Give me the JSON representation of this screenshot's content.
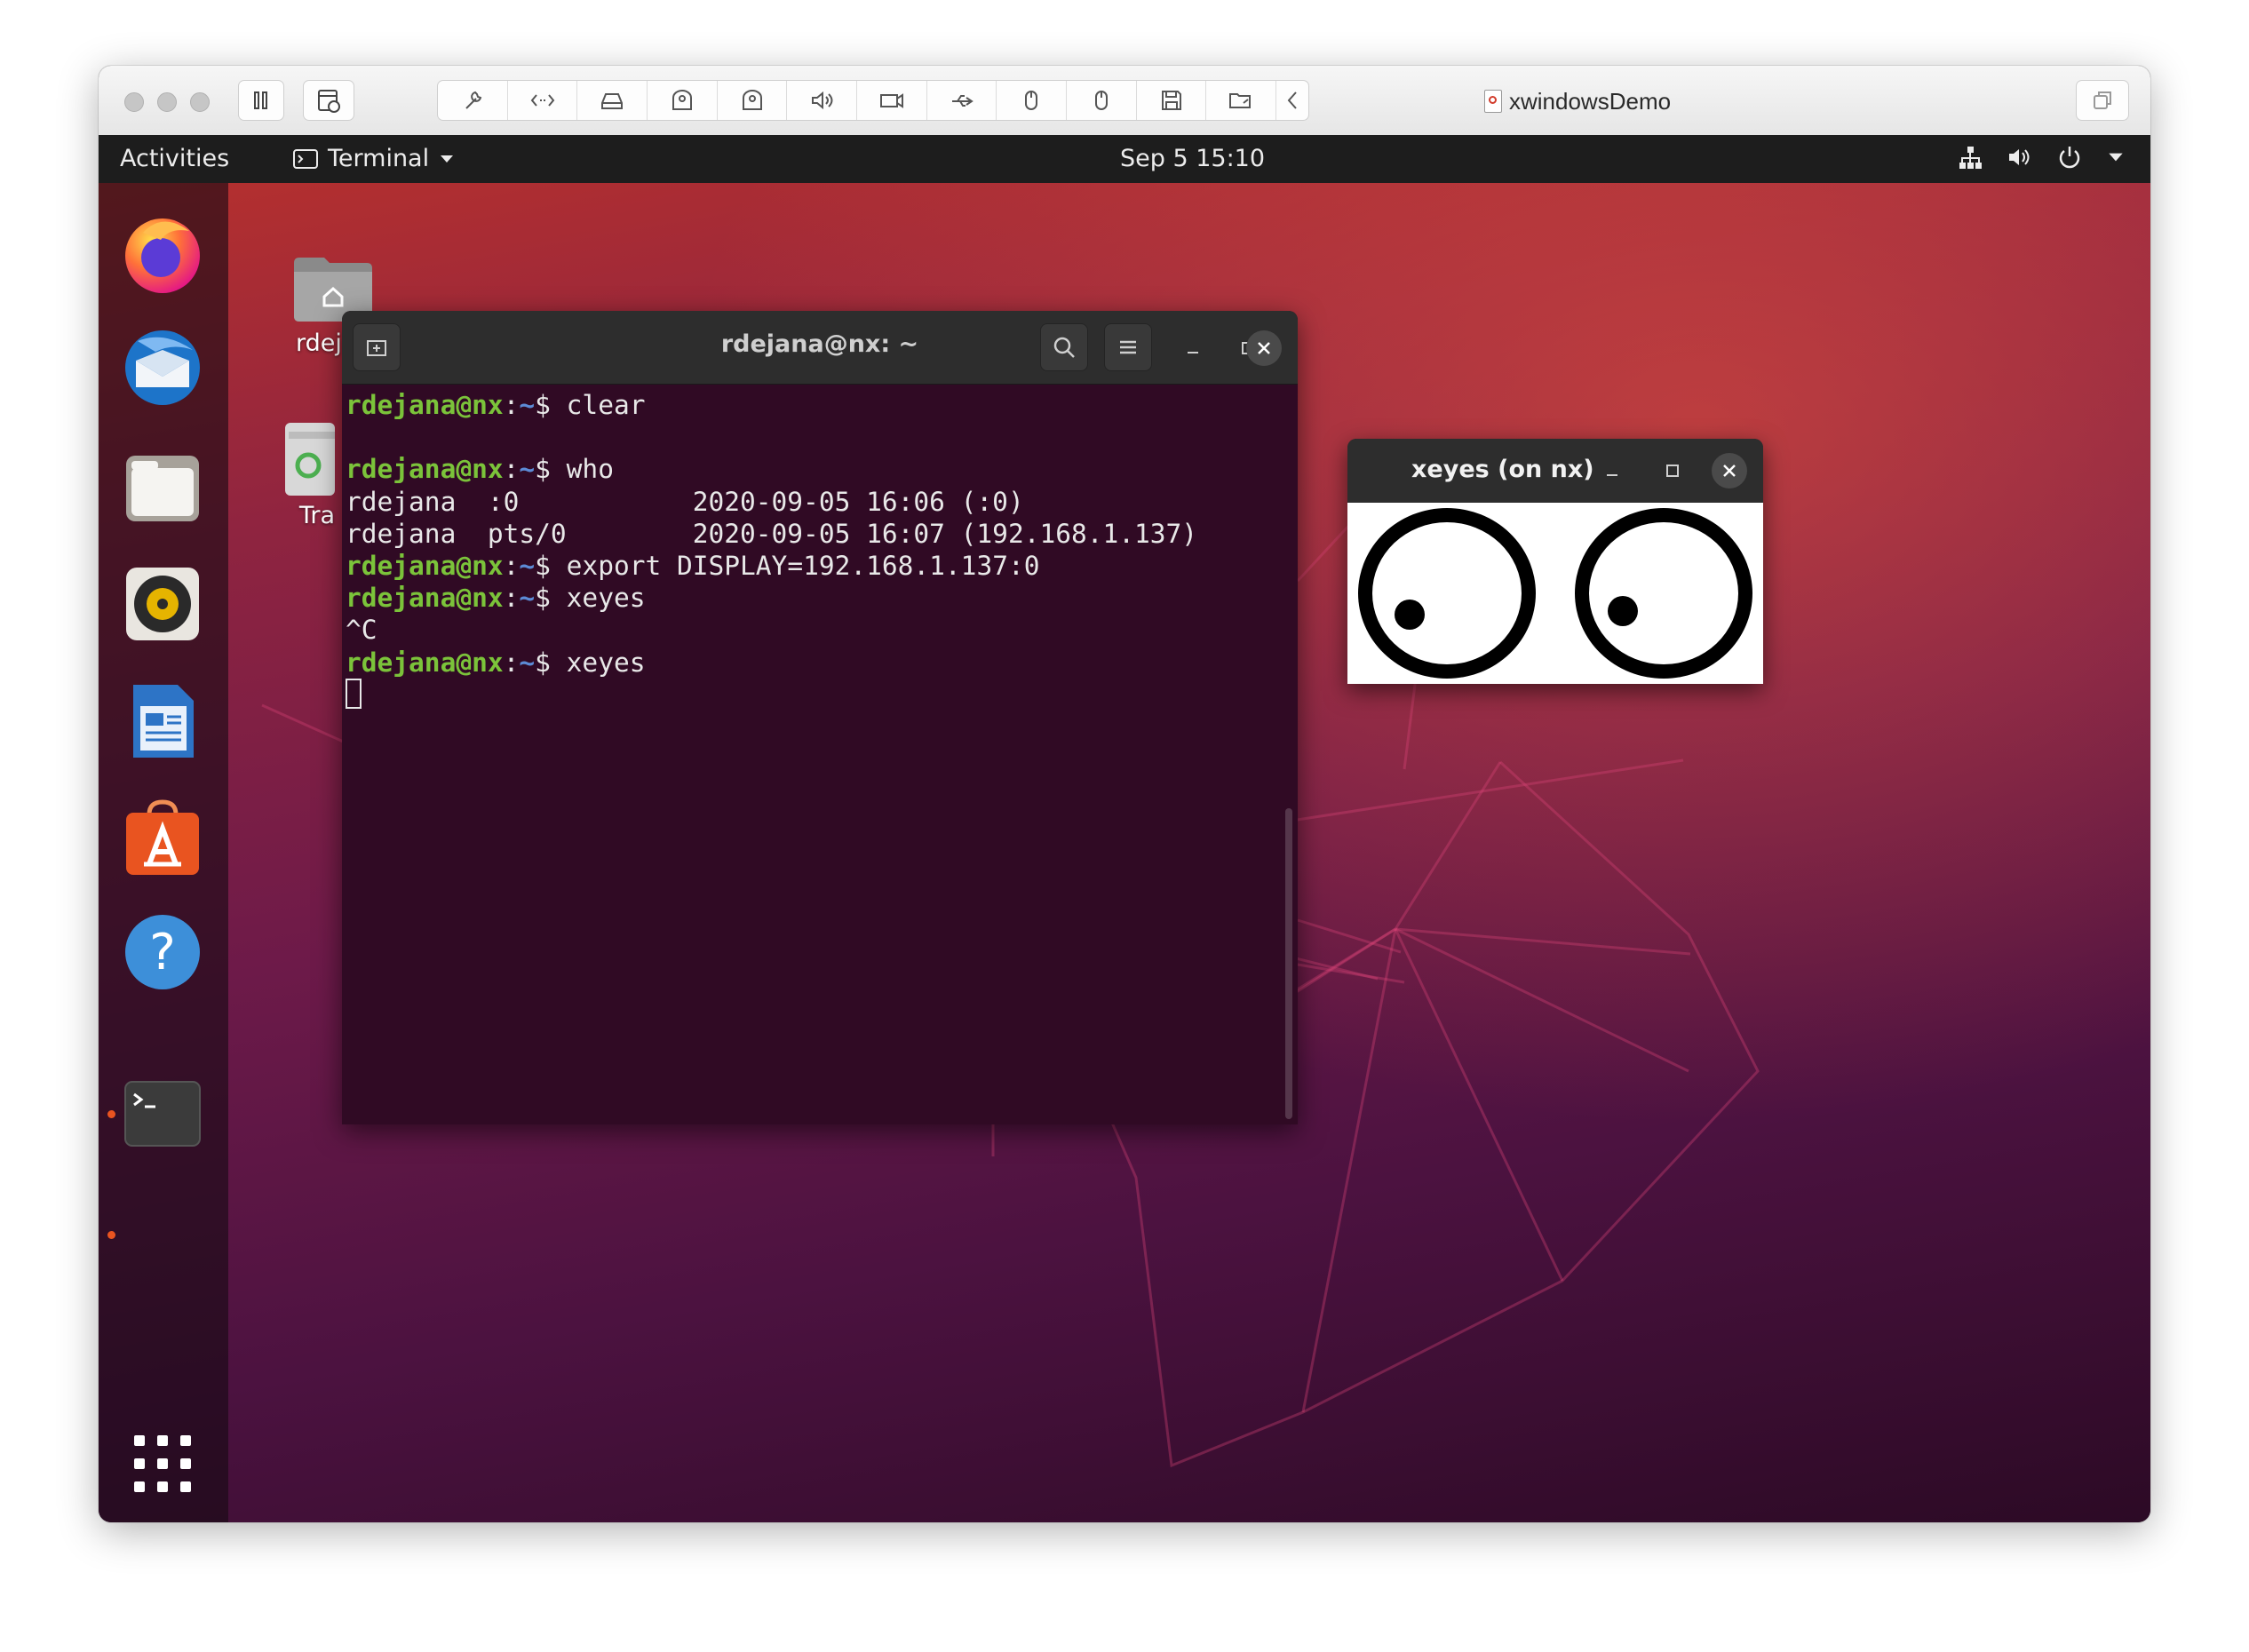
{
  "vm": {
    "window_title": "xwindowsDemo",
    "toolbar_icons": [
      "pause-icon",
      "snapshot-icon",
      "settings-icon",
      "code-icon",
      "hard-disk-icon",
      "cd-dvd-icon",
      "cd-dvd-icon",
      "sound-icon",
      "camera-icon",
      "usb-icon",
      "mouse-icon",
      "mouse-icon",
      "floppy-icon",
      "shared-folder-icon",
      "chevron-left-icon",
      "window-icon"
    ]
  },
  "topbar": {
    "activities": "Activities",
    "app_name": "Terminal",
    "clock": "Sep 5  15:10",
    "status_icons": [
      "network-icon",
      "volume-icon",
      "power-icon",
      "dropdown-arrow-icon"
    ]
  },
  "desktop": {
    "home_label": "rdej",
    "trash_label": "Tra"
  },
  "dock": {
    "apps": [
      "Firefox",
      "Thunderbird",
      "Files",
      "Rhythmbox",
      "LibreOffice Writer",
      "Ubuntu Software",
      "Help",
      "Terminal"
    ],
    "show_apps": "Show Applications"
  },
  "terminal": {
    "title": "rdejana@nx: ~",
    "prompt_user": "rdejana@nx",
    "prompt_path": "~",
    "prompt_symbol": "$ ",
    "lines": [
      {
        "cmd": "clear"
      },
      {},
      {
        "cmd": "who"
      },
      {
        "text": "rdejana  :0           2020-09-05 16:06 (:0)"
      },
      {
        "text": "rdejana  pts/0        2020-09-05 16:07 (192.168.1.137)"
      },
      {
        "cmd": "export DISPLAY=192.168.1.137:0"
      },
      {
        "cmd": "xeyes"
      },
      {
        "text": "^C"
      },
      {
        "cmd": "xeyes"
      }
    ]
  },
  "xeyes": {
    "title": "xeyes (on nx)"
  }
}
